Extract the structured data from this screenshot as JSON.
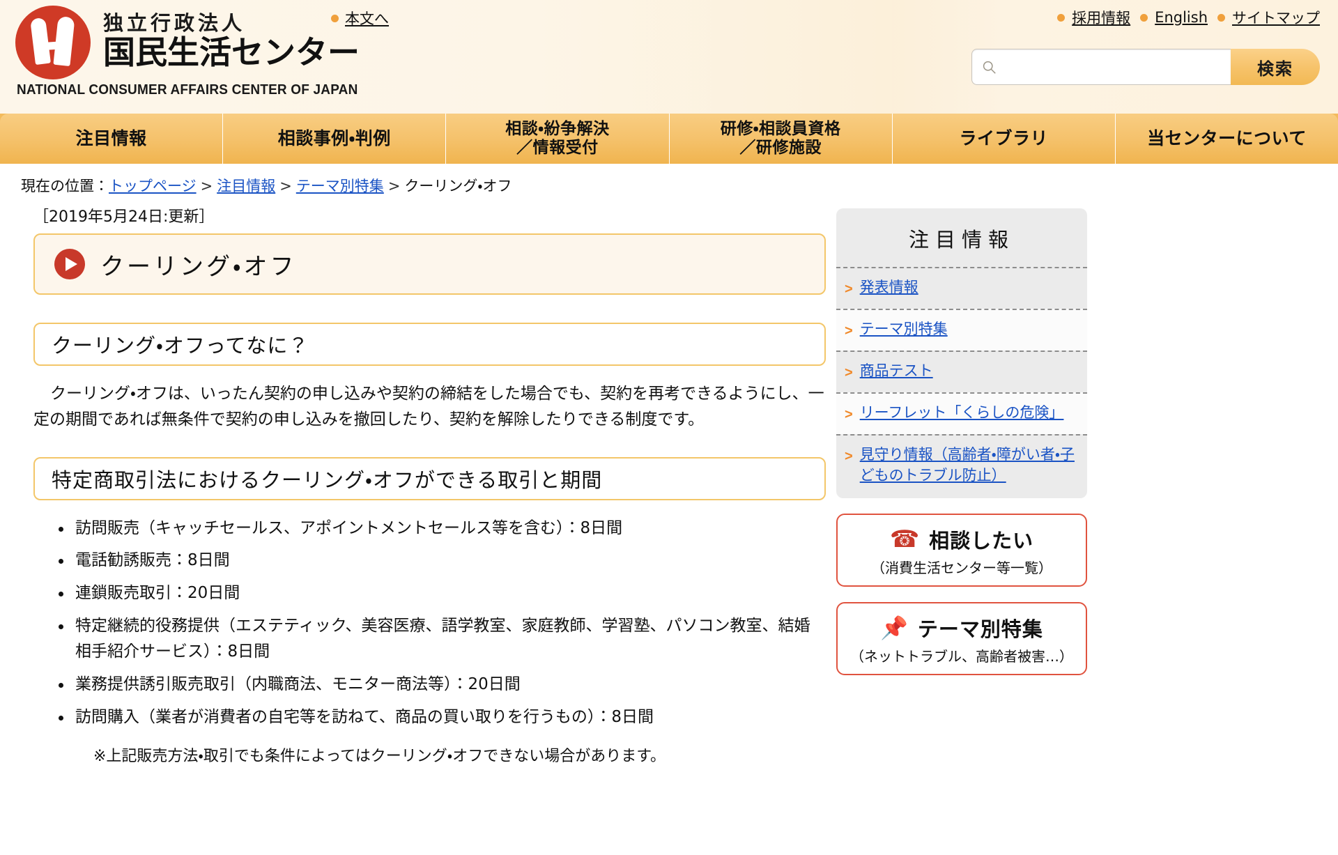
{
  "header": {
    "org_sub": "独立行政法人",
    "org_name": "国民生活センター",
    "org_en": "NATIONAL CONSUMER AFFAIRS CENTER OF JAPAN",
    "skip_link": "本文へ",
    "util_links": [
      "採用情報",
      "English",
      "サイトマップ"
    ],
    "search": {
      "value": "",
      "placeholder": "",
      "button_label": "検索",
      "icon": "search-icon"
    },
    "colors": {
      "brand_red": "#c8392a",
      "accent_orange": "#f0a03c",
      "nav_gold": "#f3bb5d",
      "link_blue": "#1a53c4"
    }
  },
  "global_nav": [
    {
      "label": "注目情報",
      "lines": [
        "注目情報"
      ]
    },
    {
      "label": "相談事例・判例",
      "lines": [
        "相談事例・判例"
      ]
    },
    {
      "label": "相談・紛争解決／情報受付",
      "lines": [
        "相談・紛争解決",
        "／情報受付"
      ]
    },
    {
      "label": "研修・相談員資格／研修施設",
      "lines": [
        "研修・相談員資格",
        "／研修施設"
      ]
    },
    {
      "label": "ライブラリ",
      "lines": [
        "ライブラリ"
      ]
    },
    {
      "label": "当センターについて",
      "lines": [
        "当センターについて"
      ]
    }
  ],
  "breadcrumb": {
    "prefix": "現在の位置：",
    "items": [
      "トップページ",
      "注目情報",
      "テーマ別特集"
    ],
    "current": "クーリング・オフ",
    "separator": ">"
  },
  "main": {
    "updated": "［2019年5月24日:更新］",
    "page_title": "クーリング・オフ",
    "sections": [
      {
        "heading": "クーリング・オフってなに？",
        "paragraph": "クーリング・オフは、いったん契約の申し込みや契約の締結をした場合でも、契約を再考できるようにし、一定の期間であれば無条件で契約の申し込みを撤回したり、契約を解除したりできる制度です。"
      },
      {
        "heading": "特定商取引法におけるクーリング・オフができる取引と期間",
        "list": [
          "訪問販売（キャッチセールス、アポイントメントセールス等を含む）：8日間",
          "電話勧誘販売：8日間",
          "連鎖販売取引：20日間",
          "特定継続的役務提供（エステティック、美容医療、語学教室、家庭教師、学習塾、パソコン教室、結婚相手紹介サービス）：8日間",
          "業務提供誘引販売取引（内職商法、モニター商法等）：20日間",
          "訪問購入（業者が消費者の自宅等を訪ねて、商品の買い取りを行うもの）：8日間"
        ],
        "note": "※上記販売方法・取引でも条件によってはクーリング・オフできない場合があります。"
      }
    ]
  },
  "aside": {
    "panel_title": "注目情報",
    "links": [
      "発表情報",
      "テーマ別特集",
      "商品テスト",
      "リーフレット「くらしの危険」",
      "見守り情報（高齢者・障がい者・子どものトラブル防止）"
    ],
    "cta": [
      {
        "icon": "phone-icon",
        "main": "相談したい",
        "sub": "（消費生活センター等一覧）"
      },
      {
        "icon": "pin-icon",
        "main": "テーマ別特集",
        "sub": "（ネットトラブル、高齢者被害…）"
      }
    ]
  }
}
